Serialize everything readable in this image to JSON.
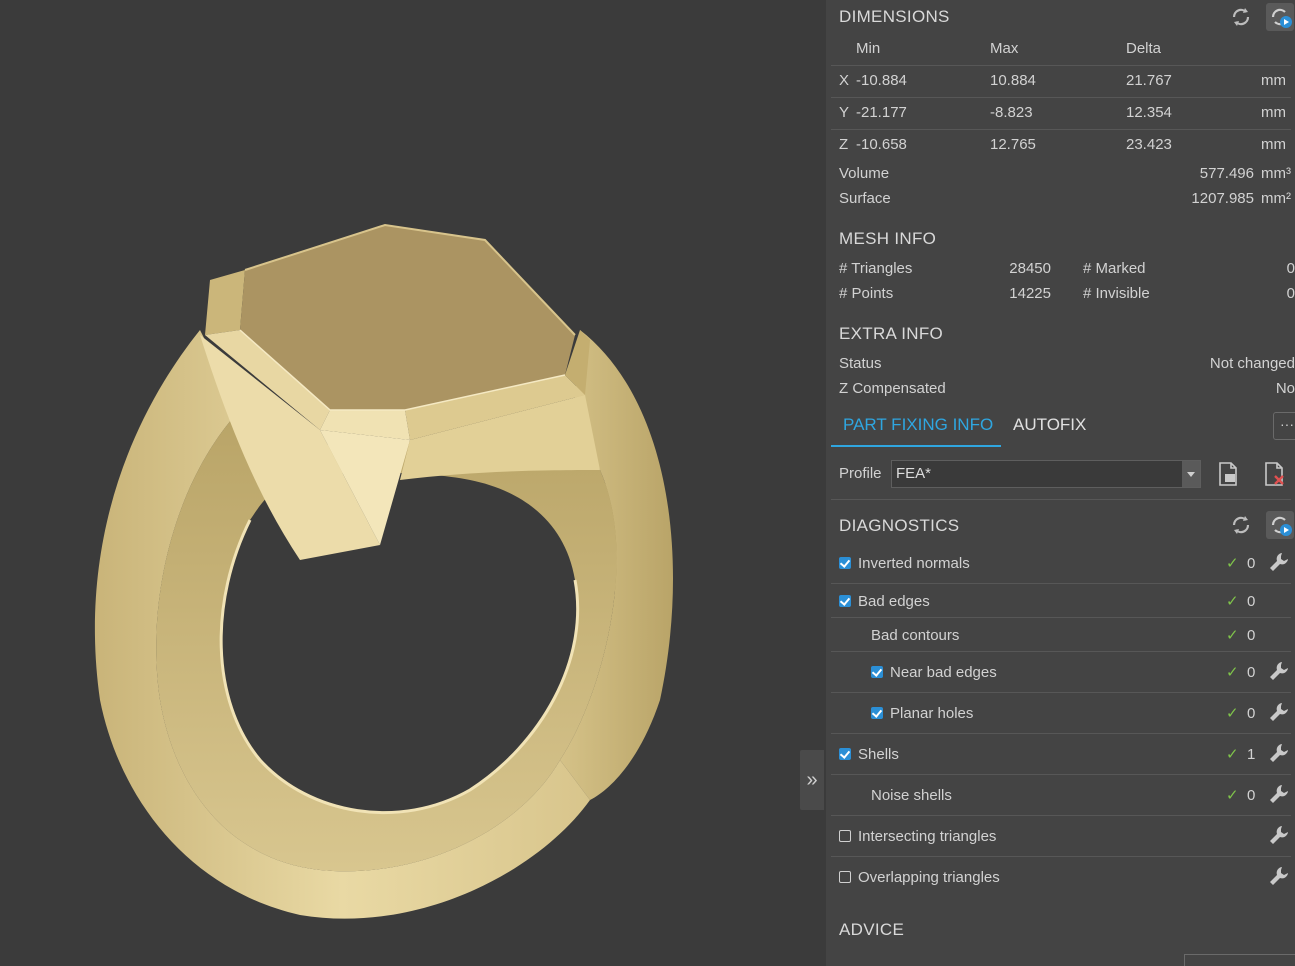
{
  "viewport": {
    "model": "ring",
    "collapse_glyph": "»"
  },
  "dimensions": {
    "title": "DIMENSIONS",
    "headers": {
      "min": "Min",
      "max": "Max",
      "delta": "Delta"
    },
    "rows": [
      {
        "axis": "X",
        "min": "-10.884",
        "max": "10.884",
        "delta": "21.767",
        "unit": "mm"
      },
      {
        "axis": "Y",
        "min": "-21.177",
        "max": "-8.823",
        "delta": "12.354",
        "unit": "mm"
      },
      {
        "axis": "Z",
        "min": "-10.658",
        "max": "12.765",
        "delta": "23.423",
        "unit": "mm"
      }
    ],
    "volume": {
      "label": "Volume",
      "value": "577.496",
      "unit": "mm³"
    },
    "surface": {
      "label": "Surface",
      "value": "1207.985",
      "unit": "mm²"
    }
  },
  "mesh_info": {
    "title": "MESH INFO",
    "triangles": {
      "label": "# Triangles",
      "value": "28450"
    },
    "points": {
      "label": "# Points",
      "value": "14225"
    },
    "marked": {
      "label": "# Marked",
      "value": "0"
    },
    "invisible": {
      "label": "# Invisible",
      "value": "0"
    }
  },
  "extra_info": {
    "title": "EXTRA INFO",
    "status": {
      "label": "Status",
      "value": "Not changed"
    },
    "z_compensated": {
      "label": "Z Compensated",
      "value": "No"
    }
  },
  "tabs": {
    "part_fixing": "PART FIXING INFO",
    "autofix": "AUTOFIX",
    "more": "···"
  },
  "profile": {
    "label": "Profile",
    "value": "FEA*"
  },
  "diagnostics": {
    "title": "DIAGNOSTICS",
    "items": [
      {
        "label": "Inverted normals",
        "checked": true,
        "count": "0"
      },
      {
        "label": "Bad edges",
        "checked": true,
        "count": "0"
      },
      {
        "label": "Bad contours",
        "count": "0"
      },
      {
        "label": "Near bad edges",
        "checked": true,
        "count": "0"
      },
      {
        "label": "Planar holes",
        "checked": true,
        "count": "0"
      },
      {
        "label": "Shells",
        "checked": true,
        "count": "1"
      },
      {
        "label": "Noise shells",
        "count": "0"
      },
      {
        "label": "Intersecting triangles",
        "checked": false
      },
      {
        "label": "Overlapping triangles",
        "checked": false
      }
    ],
    "ok_glyph": "✓"
  },
  "advice": {
    "title": "ADVICE"
  },
  "colors": {
    "accent": "#2fa6e0",
    "ok": "#7fc34a",
    "panel": "#444444",
    "viewport": "#3b3b3b",
    "ring": "#e6d49c"
  },
  "icons": [
    "refresh-icon",
    "auto-update-icon",
    "export-report-icon",
    "delete-report-icon",
    "wrench-icon",
    "checkbox-icon",
    "chevron-down-icon"
  ]
}
